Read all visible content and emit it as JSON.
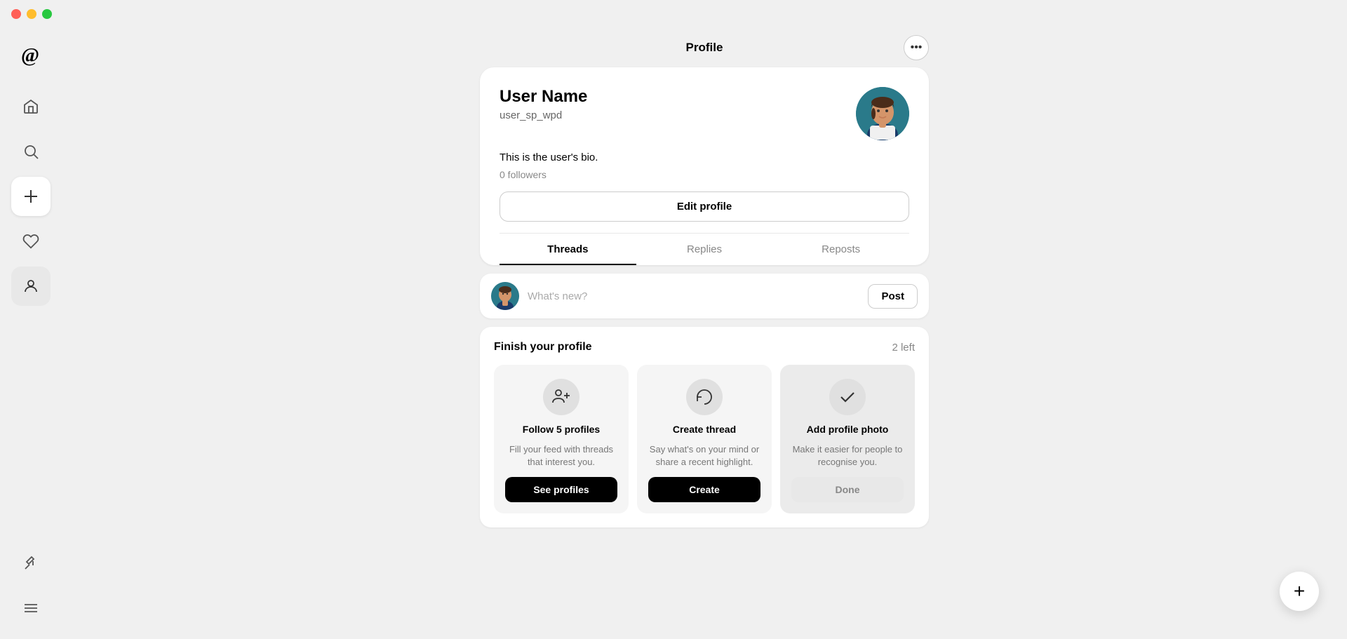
{
  "titleBar": {
    "trafficLights": [
      "red",
      "yellow",
      "green"
    ]
  },
  "sidebar": {
    "logo": "Ⓣ",
    "items": [
      {
        "id": "home",
        "icon": "⌂",
        "label": "Home",
        "active": false
      },
      {
        "id": "search",
        "icon": "⌕",
        "label": "Search",
        "active": false
      },
      {
        "id": "create",
        "icon": "+",
        "label": "Create",
        "active": false
      },
      {
        "id": "activity",
        "icon": "♡",
        "label": "Activity",
        "active": false
      },
      {
        "id": "profile",
        "icon": "👤",
        "label": "Profile",
        "active": true
      }
    ],
    "bottomItems": [
      {
        "id": "pin",
        "icon": "📌",
        "label": "Pin"
      },
      {
        "id": "menu",
        "icon": "≡",
        "label": "Menu"
      }
    ]
  },
  "header": {
    "title": "Profile",
    "menuIcon": "•••"
  },
  "profile": {
    "name": "User Name",
    "handle": "user_sp_wpd",
    "bio": "This is the user's bio.",
    "followers": "0 followers",
    "editButtonLabel": "Edit profile"
  },
  "tabs": [
    {
      "id": "threads",
      "label": "Threads",
      "active": true
    },
    {
      "id": "replies",
      "label": "Replies",
      "active": false
    },
    {
      "id": "reposts",
      "label": "Reposts",
      "active": false
    }
  ],
  "newThread": {
    "placeholder": "What's new?",
    "postButtonLabel": "Post"
  },
  "finishProfile": {
    "title": "Finish your profile",
    "count": "2 left",
    "cards": [
      {
        "id": "follow",
        "icon": "👥+",
        "title": "Follow 5 profiles",
        "description": "Fill your feed with threads that interest you.",
        "buttonLabel": "See profiles",
        "completed": false
      },
      {
        "id": "thread",
        "icon": "↻",
        "title": "Create thread",
        "description": "Say what's on your mind or share a recent highlight.",
        "buttonLabel": "Create",
        "completed": false
      },
      {
        "id": "photo",
        "icon": "✓",
        "title": "Add profile photo",
        "description": "Make it easier for people to recognise you.",
        "buttonLabel": "Done",
        "completed": true
      }
    ]
  },
  "fab": {
    "icon": "+"
  }
}
